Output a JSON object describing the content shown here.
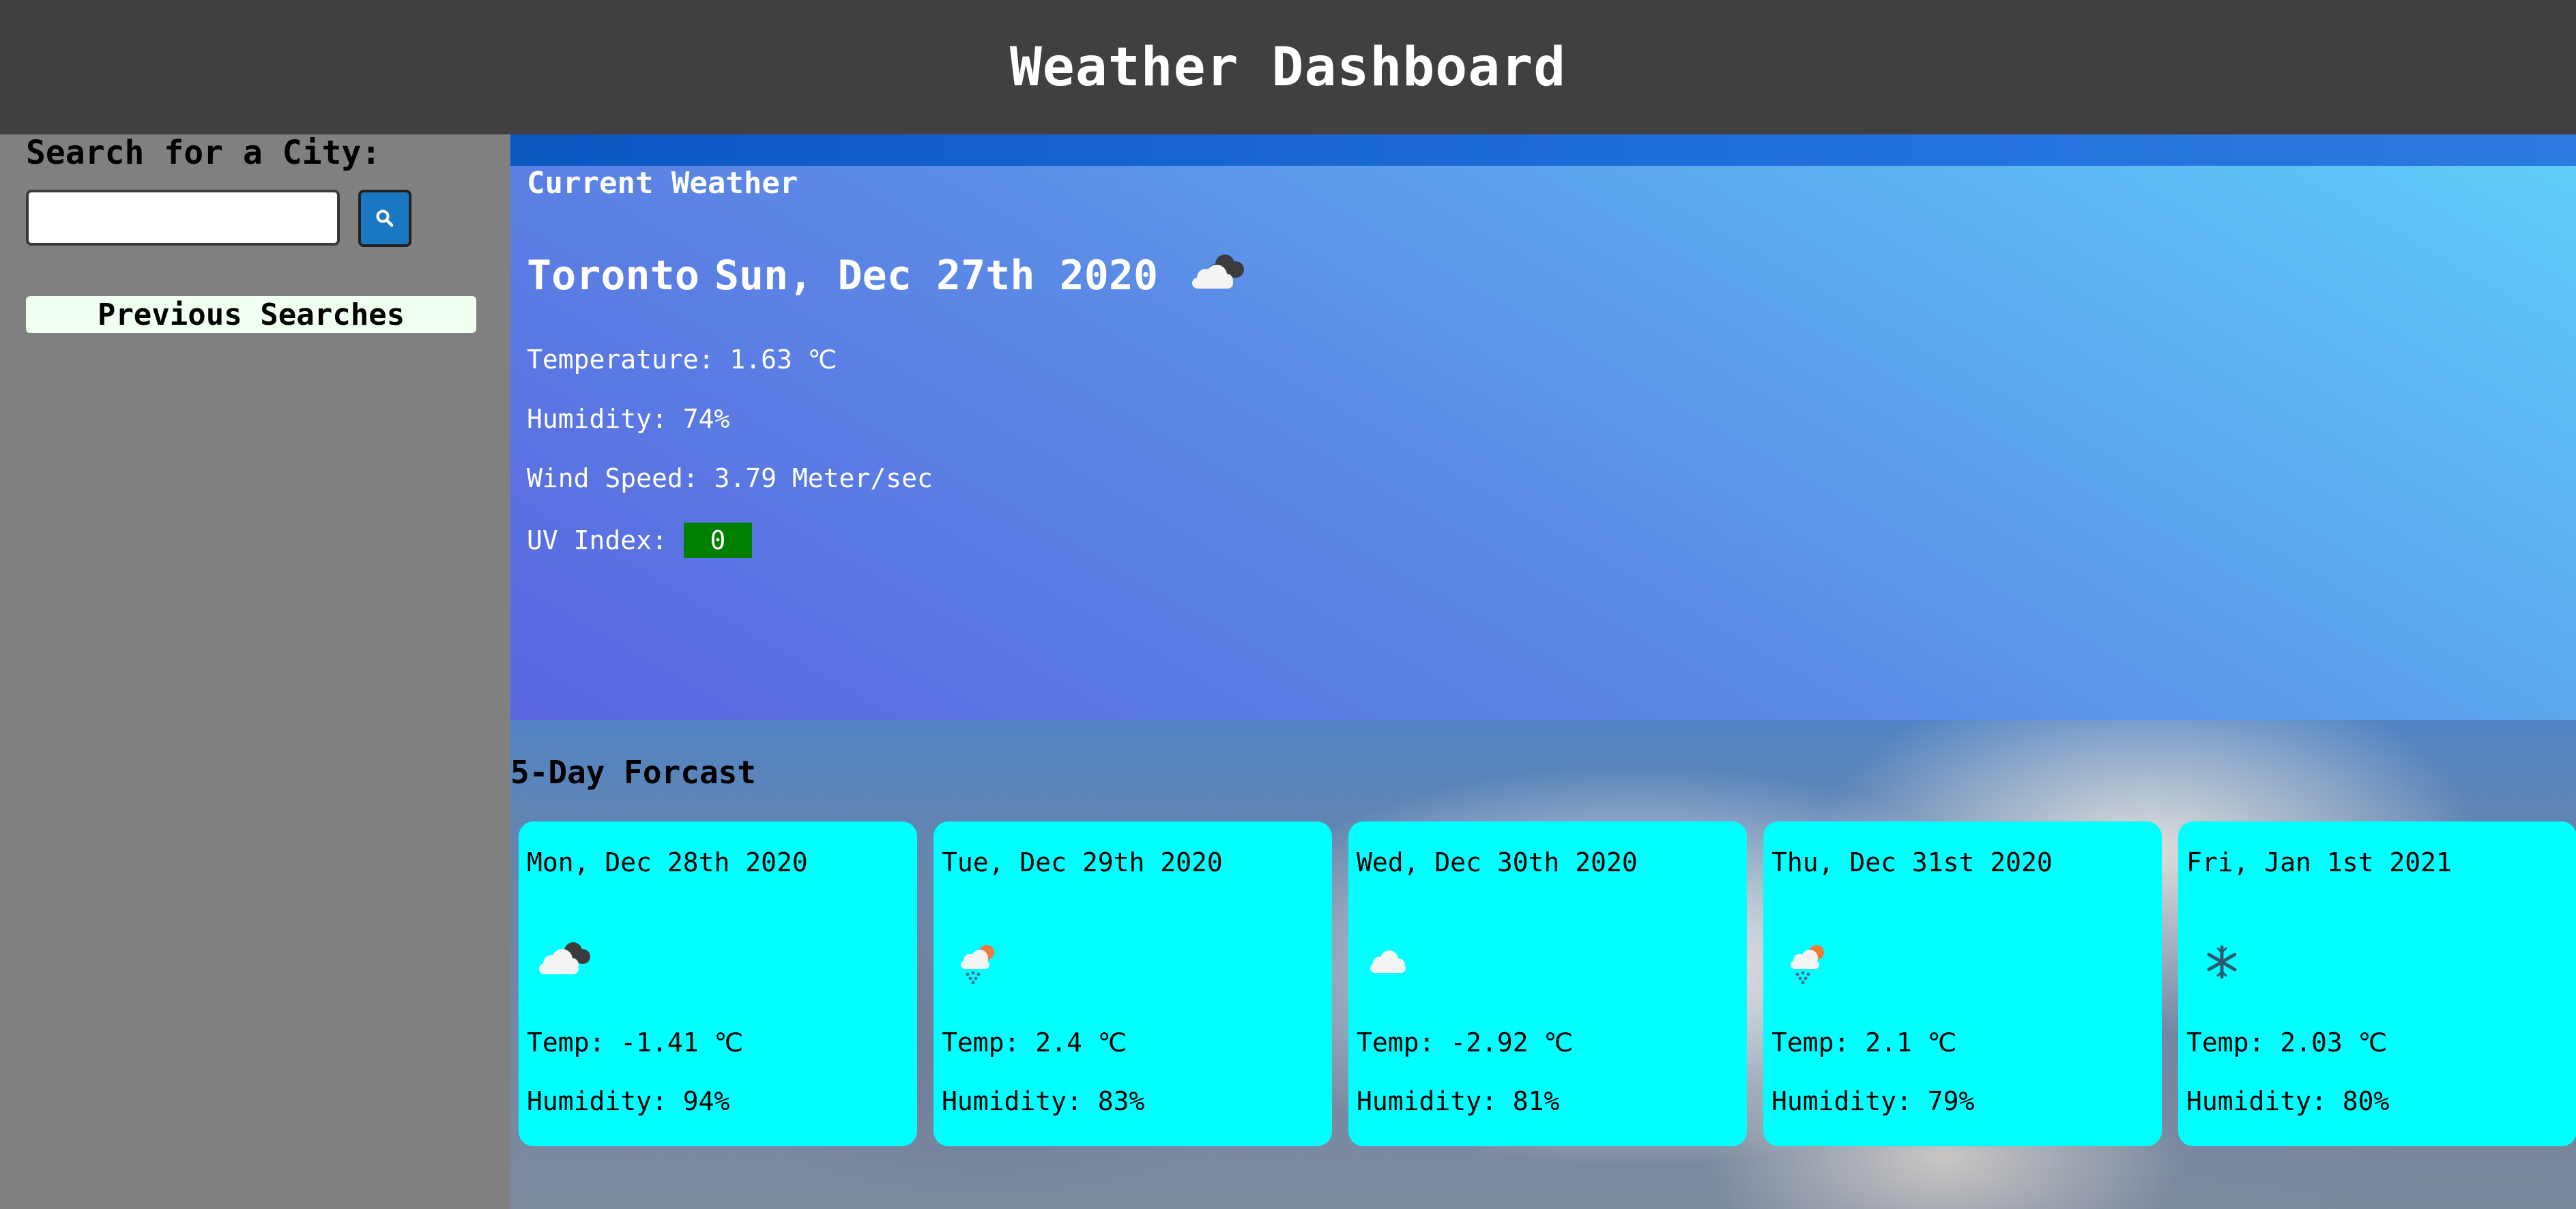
{
  "header": {
    "title": "Weather Dashboard"
  },
  "sidebar": {
    "search_label": "Search for a City:",
    "search_value": "",
    "search_placeholder": "",
    "previous_searches_label": "Previous Searches"
  },
  "current": {
    "heading": "Current Weather",
    "city": "Toronto",
    "date": "Sun, Dec 27th 2020",
    "icon": "clouds-icon",
    "temperature": "Temperature: 1.63 ℃",
    "humidity": "Humidity: 74%",
    "wind": "Wind Speed: 3.79 Meter/sec",
    "uv_label": "UV Index:",
    "uv_value": "0",
    "uv_color": "#008000"
  },
  "forecast": {
    "heading": "5-Day Forcast",
    "days": [
      {
        "date": "Mon, Dec 28th 2020",
        "icon": "broken-clouds-icon",
        "temp": "Temp: -1.41 ℃",
        "humidity": "Humidity: 94%"
      },
      {
        "date": "Tue, Dec 29th 2020",
        "icon": "rain-snow-sun-icon",
        "temp": "Temp: 2.4 ℃",
        "humidity": "Humidity: 83%"
      },
      {
        "date": "Wed, Dec 30th 2020",
        "icon": "cloud-icon",
        "temp": "Temp: -2.92 ℃",
        "humidity": "Humidity: 81%"
      },
      {
        "date": "Thu, Dec 31st 2020",
        "icon": "rain-snow-sun-icon",
        "temp": "Temp: 2.1 ℃",
        "humidity": "Humidity: 79%"
      },
      {
        "date": "Fri, Jan 1st 2021",
        "icon": "snowflake-icon",
        "temp": "Temp: 2.03 ℃",
        "humidity": "Humidity: 80%"
      }
    ]
  },
  "colors": {
    "header_bg": "#404040",
    "sidebar_bg": "#808080",
    "card_bg": "#00ffff",
    "search_button_bg": "#1a78c2"
  }
}
